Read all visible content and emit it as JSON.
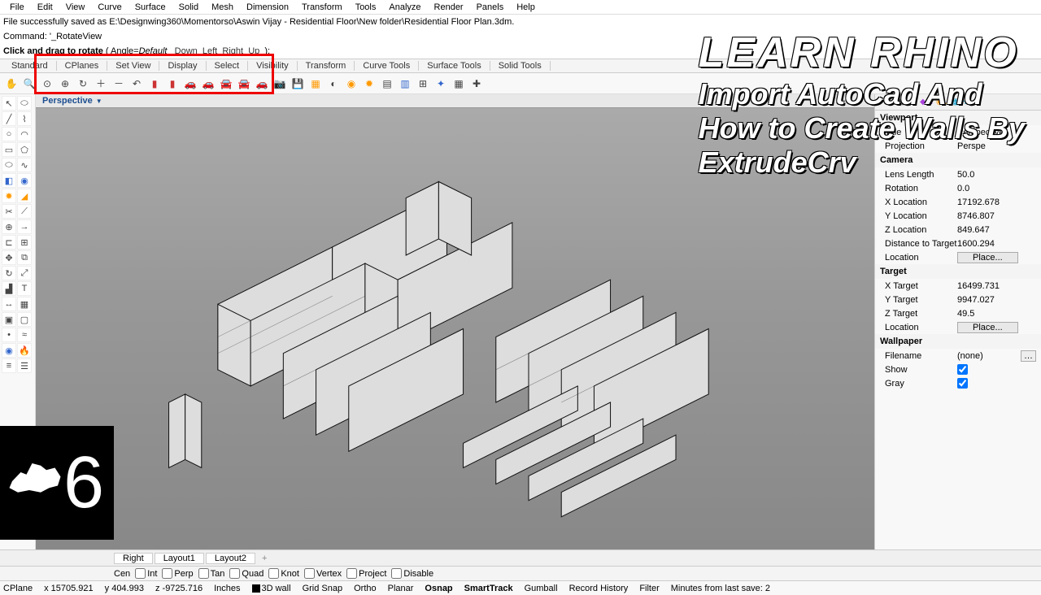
{
  "menu": [
    "File",
    "Edit",
    "View",
    "Curve",
    "Surface",
    "Solid",
    "Mesh",
    "Dimension",
    "Transform",
    "Tools",
    "Analyze",
    "Render",
    "Panels",
    "Help"
  ],
  "cmd": {
    "line1": "File successfully saved as E:\\Designwing360\\Momentorso\\Aswin Vijay - Residential Floor\\New folder\\Residential Floor Plan.3dm.",
    "line2a": "Command:",
    "line2b": "'_RotateView",
    "line3a": "Click and drag to rotate",
    "line3b": "( Angle=",
    "line3c": "Default",
    "links": [
      "Down",
      "Left",
      "Right",
      "Up"
    ],
    "line3d": "):"
  },
  "tabs": [
    "Standard",
    "CPlanes",
    "Set View",
    "Display",
    "Select",
    "Visibility",
    "Transform",
    "Curve Tools",
    "Surface Tools",
    "Solid Tools"
  ],
  "viewport_label": "Perspective",
  "props": {
    "viewport_head": "Viewport",
    "title_lbl": "Title",
    "title_val": "Perspective",
    "proj_lbl": "Projection",
    "proj_val": "Perspe",
    "camera_head": "Camera",
    "lens_lbl": "Lens Length",
    "lens_val": "50.0",
    "rot_lbl": "Rotation",
    "rot_val": "0.0",
    "xloc_lbl": "X Location",
    "xloc_val": "17192.678",
    "yloc_lbl": "Y Location",
    "yloc_val": "8746.807",
    "zloc_lbl": "Z Location",
    "zloc_val": "849.647",
    "dist_lbl": "Distance to Target",
    "dist_val": "1600.294",
    "loc_lbl": "Location",
    "place_btn": "Place...",
    "target_head": "Target",
    "xt_lbl": "X Target",
    "xt_val": "16499.731",
    "yt_lbl": "Y Target",
    "yt_val": "9947.027",
    "zt_lbl": "Z Target",
    "zt_val": "49.5",
    "wallpaper_head": "Wallpaper",
    "file_lbl": "Filename",
    "file_val": "(none)",
    "show_lbl": "Show",
    "gray_lbl": "Gray"
  },
  "vtabs": [
    "Right",
    "Layout1",
    "Layout2"
  ],
  "osnap_start": "Cen",
  "osnap": [
    "Int",
    "Perp",
    "Tan",
    "Quad",
    "Knot",
    "Vertex",
    "Project",
    "Disable"
  ],
  "status": {
    "cplane": "CPlane",
    "x": "x 15705.921",
    "y": "y 404.993",
    "z": "z -9725.716",
    "units": "Inches",
    "layer": "3D wall",
    "items": [
      "Grid Snap",
      "Ortho",
      "Planar",
      "Osnap",
      "SmartTrack",
      "Gumball",
      "Record History",
      "Filter"
    ],
    "minutes": "Minutes from last save: 2"
  },
  "overlay": {
    "l1": "LEARN RHINO",
    "l2": "Import AutoCad And",
    "l3": "How to Create Walls By",
    "l4": "ExtrudeCrv"
  },
  "logo_num": "6"
}
